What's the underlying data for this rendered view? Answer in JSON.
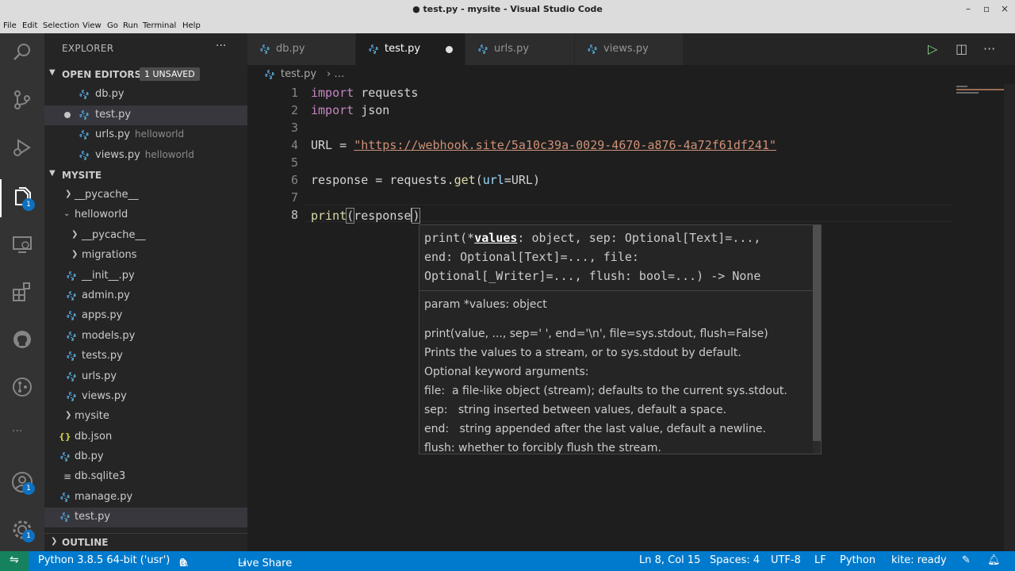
{
  "window": {
    "title": "● test.py - mysite - Visual Studio Code",
    "controls": [
      "–",
      "▫",
      "×"
    ]
  },
  "menu": [
    "File",
    "Edit",
    "Selection",
    "View",
    "Go",
    "Run",
    "Terminal",
    "Help"
  ],
  "activity_bar": {
    "explorer_badge": "1",
    "accounts_badge": "1",
    "settings_badge": "1",
    "more": "···"
  },
  "sidebar": {
    "title": "EXPLORER",
    "more": "···",
    "open_editors": {
      "label": "OPEN EDITORS",
      "badge": "1 UNSAVED",
      "items": [
        {
          "name": "db.py",
          "desc": ""
        },
        {
          "name": "test.py",
          "desc": ""
        },
        {
          "name": "urls.py",
          "desc": "helloworld"
        },
        {
          "name": "views.py",
          "desc": "helloworld"
        }
      ]
    },
    "workspace": {
      "label": "MYSITE",
      "items": [
        {
          "name": "__pycache__"
        },
        {
          "name": "helloworld"
        },
        {
          "name": "__pycache__"
        },
        {
          "name": "migrations"
        },
        {
          "name": "__init__.py"
        },
        {
          "name": "admin.py"
        },
        {
          "name": "apps.py"
        },
        {
          "name": "models.py"
        },
        {
          "name": "tests.py"
        },
        {
          "name": "urls.py"
        },
        {
          "name": "views.py"
        },
        {
          "name": "mysite"
        },
        {
          "name": "db.json"
        },
        {
          "name": "db.py"
        },
        {
          "name": "db.sqlite3"
        },
        {
          "name": "manage.py"
        },
        {
          "name": "test.py"
        }
      ]
    },
    "outline": "OUTLINE"
  },
  "tabs": [
    {
      "label": "db.py"
    },
    {
      "label": "test.py"
    },
    {
      "label": "urls.py"
    },
    {
      "label": "views.py"
    }
  ],
  "breadcrumb": {
    "file": "test.py",
    "sep": "› …"
  },
  "editor": {
    "line_numbers": [
      "1",
      "2",
      "3",
      "4",
      "5",
      "6",
      "7",
      "8"
    ],
    "lines": {
      "l1_kw": "import",
      "l1_mod": " requests",
      "l2_kw": "import",
      "l2_mod": " json",
      "l4_var": "URL",
      "l4_eq": " = ",
      "l4_str": "\"https://webhook.site/5a10c39a-0029-4670-a876-4a72f61df241\"",
      "l6_var": "response",
      "l6_eq": " = requests.",
      "l6_fn": "get",
      "l6_open": "(",
      "l6_param": "url",
      "l6_rest": "=URL)",
      "l8_fn": "print",
      "l8_open": "(",
      "l8_arg": "response",
      "l8_close": ")"
    }
  },
  "signature_help": {
    "sig_prefix": "print(*",
    "sig_active": "values",
    "sig_rest": ": object, sep: Optional[Text]=...,\nend: Optional[Text]=..., file:\nOptional[_Writer]=..., flush: bool=...) -> None",
    "param": "param *values: object",
    "doc": [
      "print(value, ..., sep=' ', end='\\n', file=sys.stdout, flush=False)",
      "Prints the values to a stream, or to sys.stdout by default.",
      "Optional keyword arguments:",
      "file:  a file-like object (stream); defaults to the current sys.stdout.",
      "sep:   string inserted between values, default a space.",
      "end:   string appended after the last value, default a newline.",
      "flush: whether to forcibly flush the stream."
    ]
  },
  "statusbar": {
    "interpreter": "Python 3.8.5 64-bit ('usr')",
    "errors": "0",
    "warnings": "0",
    "live_share": "Live Share",
    "position": "Ln 8, Col 15",
    "spaces": "Spaces: 4",
    "encoding": "UTF-8",
    "eol": "LF",
    "language": "Python",
    "kite": "kite: ready"
  },
  "colors": {
    "statusbar": "#007acc",
    "remote": "#16825d",
    "keyword": "#c586c0",
    "string": "#ce9178",
    "function": "#dcdcaa",
    "variable": "#9cdcfe"
  }
}
